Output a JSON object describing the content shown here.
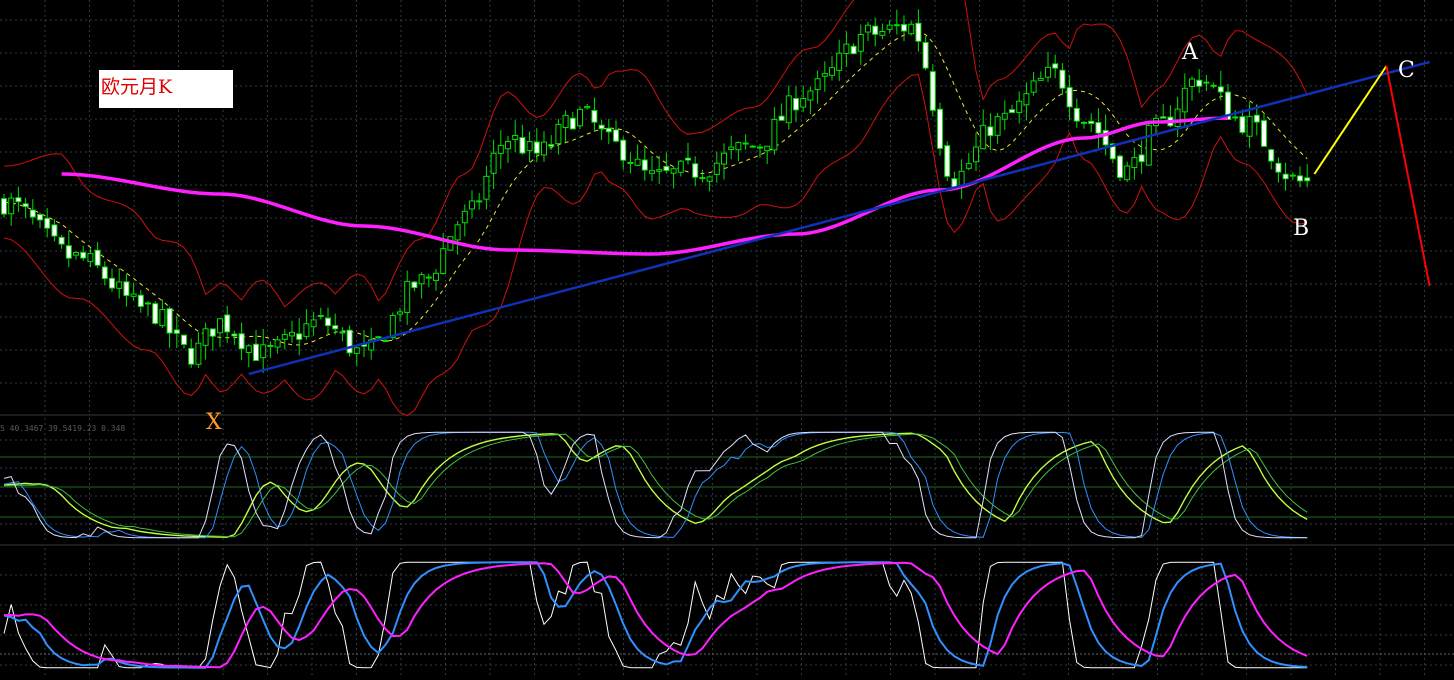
{
  "title": "欧元月K",
  "indicator_readout": "5 40.3467 39.5419.23 0.348",
  "wave_labels": {
    "x": "X",
    "a": "A",
    "b": "B",
    "c": "C"
  },
  "colors": {
    "background": "#000000",
    "grid": "#2d3e3e",
    "candle_up": "#00e000",
    "candle_down": "#ffffff",
    "bollinger": "#d01010",
    "bollinger_mid": "#e8e830",
    "long_ma": "#ff20ff",
    "trendline": "#1030b8",
    "projection_up": "#ffff00",
    "projection_down": "#ff0000",
    "k_line": "#e0e0ff",
    "d_line": "#3090ff",
    "signal_1": "#c0ff40",
    "signal_2": "#40c040",
    "osc_white": "#ffffff",
    "osc_blue": "#3090ff",
    "osc_magenta": "#ff20ff"
  },
  "chart_data": {
    "type": "candlestick",
    "title": "欧元月K",
    "y_range": [
      0,
      100
    ],
    "price_path": [
      {
        "i": 0,
        "v": 52
      },
      {
        "i": 10,
        "v": 38
      },
      {
        "i": 20,
        "v": 25
      },
      {
        "i": 26,
        "v": 14
      },
      {
        "i": 30,
        "v": 22
      },
      {
        "i": 36,
        "v": 14
      },
      {
        "i": 44,
        "v": 22
      },
      {
        "i": 50,
        "v": 14
      },
      {
        "i": 58,
        "v": 32
      },
      {
        "i": 64,
        "v": 48
      },
      {
        "i": 70,
        "v": 68
      },
      {
        "i": 74,
        "v": 64
      },
      {
        "i": 80,
        "v": 74
      },
      {
        "i": 85,
        "v": 66
      },
      {
        "i": 90,
        "v": 58
      },
      {
        "i": 96,
        "v": 60
      },
      {
        "i": 104,
        "v": 66
      },
      {
        "i": 112,
        "v": 80
      },
      {
        "i": 120,
        "v": 94
      },
      {
        "i": 126,
        "v": 96
      },
      {
        "i": 132,
        "v": 58
      },
      {
        "i": 138,
        "v": 72
      },
      {
        "i": 146,
        "v": 84
      },
      {
        "i": 150,
        "v": 73
      },
      {
        "i": 156,
        "v": 60
      },
      {
        "i": 160,
        "v": 70
      },
      {
        "i": 166,
        "v": 83
      },
      {
        "i": 172,
        "v": 72
      },
      {
        "i": 180,
        "v": 57
      }
    ],
    "long_ma": [
      {
        "i": 8,
        "v": 59
      },
      {
        "i": 30,
        "v": 54
      },
      {
        "i": 50,
        "v": 46
      },
      {
        "i": 70,
        "v": 40
      },
      {
        "i": 90,
        "v": 39
      },
      {
        "i": 110,
        "v": 44
      },
      {
        "i": 130,
        "v": 55
      },
      {
        "i": 150,
        "v": 68
      },
      {
        "i": 160,
        "v": 72
      },
      {
        "i": 170,
        "v": 73
      }
    ],
    "trendline": {
      "from": {
        "i": 34,
        "v": 9
      },
      "to": {
        "i": 198,
        "v": 87
      }
    },
    "projection": [
      {
        "i": 182,
        "v": 59
      },
      {
        "i": 192,
        "v": 86
      },
      {
        "i": 198,
        "v": 31
      }
    ],
    "annotations": [
      {
        "label": "X",
        "i": 28,
        "v": 14
      },
      {
        "label": "A",
        "i": 162,
        "v": 84
      },
      {
        "label": "B",
        "i": 178,
        "v": 57
      },
      {
        "label": "C",
        "i": 192,
        "v": 86
      }
    ]
  }
}
